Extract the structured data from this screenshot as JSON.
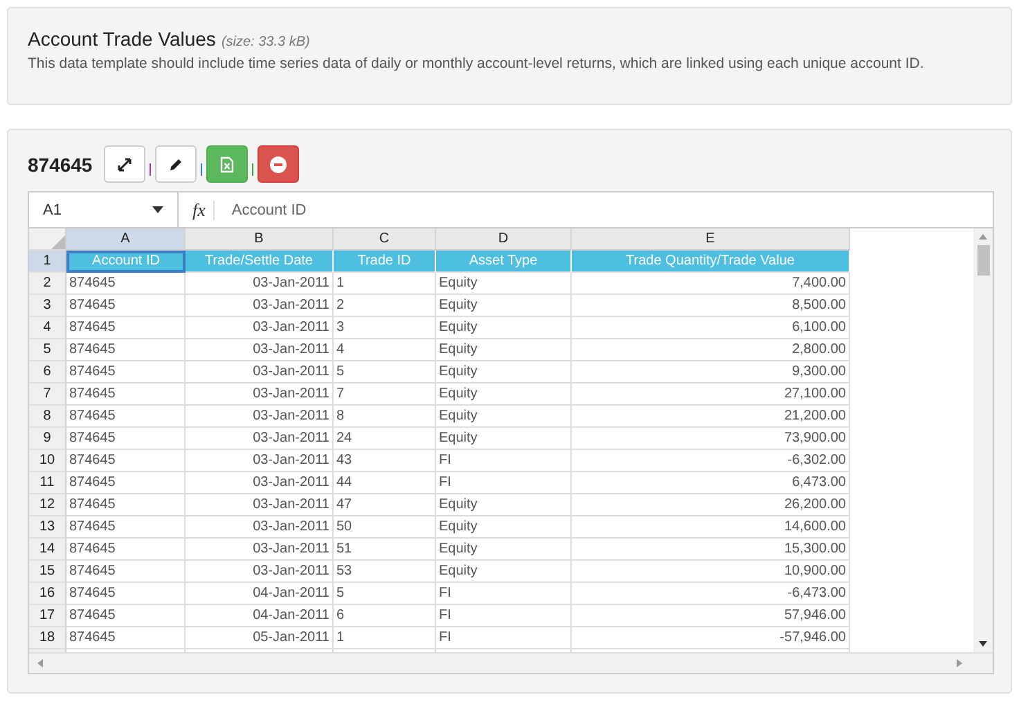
{
  "header": {
    "title": "Account Trade Values",
    "size": "(size: 33.3 kB)",
    "description": "This data template should include time series data of daily or monthly account-level returns, which are linked using each unique account ID."
  },
  "sheet": {
    "title": "874645",
    "toolbar": [
      {
        "kind": "expand"
      },
      {
        "kind": "edit"
      },
      {
        "kind": "excel"
      },
      {
        "kind": "remove"
      }
    ],
    "name_box": "A1",
    "fx": "fx",
    "formula": "Account ID",
    "columns": [
      {
        "label": "A",
        "selected": true,
        "right_aligned": false
      },
      {
        "label": "B",
        "selected": false,
        "right_aligned": true
      },
      {
        "label": "C",
        "selected": false,
        "right_aligned": false
      },
      {
        "label": "D",
        "selected": false,
        "right_aligned": false
      },
      {
        "label": "E",
        "selected": false,
        "right_aligned": true
      }
    ],
    "header_row": {
      "number": "1",
      "selected": true,
      "cells": [
        {
          "text": "Account ID",
          "selected": true
        },
        {
          "text": "Trade/Settle Date",
          "selected": false
        },
        {
          "text": "Trade ID",
          "selected": false
        },
        {
          "text": "Asset Type",
          "selected": false
        },
        {
          "text": "Trade Quantity/Trade Value",
          "selected": false
        }
      ]
    },
    "rows": [
      {
        "number": "2",
        "selected": false,
        "cells": [
          "874645",
          "03-Jan-2011",
          "1",
          "Equity",
          "7,400.00"
        ]
      },
      {
        "number": "3",
        "selected": false,
        "cells": [
          "874645",
          "03-Jan-2011",
          "2",
          "Equity",
          "8,500.00"
        ]
      },
      {
        "number": "4",
        "selected": false,
        "cells": [
          "874645",
          "03-Jan-2011",
          "3",
          "Equity",
          "6,100.00"
        ]
      },
      {
        "number": "5",
        "selected": false,
        "cells": [
          "874645",
          "03-Jan-2011",
          "4",
          "Equity",
          "2,800.00"
        ]
      },
      {
        "number": "6",
        "selected": false,
        "cells": [
          "874645",
          "03-Jan-2011",
          "5",
          "Equity",
          "9,300.00"
        ]
      },
      {
        "number": "7",
        "selected": false,
        "cells": [
          "874645",
          "03-Jan-2011",
          "7",
          "Equity",
          "27,100.00"
        ]
      },
      {
        "number": "8",
        "selected": false,
        "cells": [
          "874645",
          "03-Jan-2011",
          "8",
          "Equity",
          "21,200.00"
        ]
      },
      {
        "number": "9",
        "selected": false,
        "cells": [
          "874645",
          "03-Jan-2011",
          "24",
          "Equity",
          "73,900.00"
        ]
      },
      {
        "number": "10",
        "selected": false,
        "cells": [
          "874645",
          "03-Jan-2011",
          "43",
          "FI",
          "-6,302.00"
        ]
      },
      {
        "number": "11",
        "selected": false,
        "cells": [
          "874645",
          "03-Jan-2011",
          "44",
          "FI",
          "6,473.00"
        ]
      },
      {
        "number": "12",
        "selected": false,
        "cells": [
          "874645",
          "03-Jan-2011",
          "47",
          "Equity",
          "26,200.00"
        ]
      },
      {
        "number": "13",
        "selected": false,
        "cells": [
          "874645",
          "03-Jan-2011",
          "50",
          "Equity",
          "14,600.00"
        ]
      },
      {
        "number": "14",
        "selected": false,
        "cells": [
          "874645",
          "03-Jan-2011",
          "51",
          "Equity",
          "15,300.00"
        ]
      },
      {
        "number": "15",
        "selected": false,
        "cells": [
          "874645",
          "03-Jan-2011",
          "53",
          "Equity",
          "10,900.00"
        ]
      },
      {
        "number": "16",
        "selected": false,
        "cells": [
          "874645",
          "04-Jan-2011",
          "5",
          "FI",
          "-6,473.00"
        ]
      },
      {
        "number": "17",
        "selected": false,
        "cells": [
          "874645",
          "04-Jan-2011",
          "6",
          "FI",
          "57,946.00"
        ]
      },
      {
        "number": "18",
        "selected": false,
        "cells": [
          "874645",
          "05-Jan-2011",
          "1",
          "FI",
          "-57,946.00"
        ]
      }
    ]
  }
}
